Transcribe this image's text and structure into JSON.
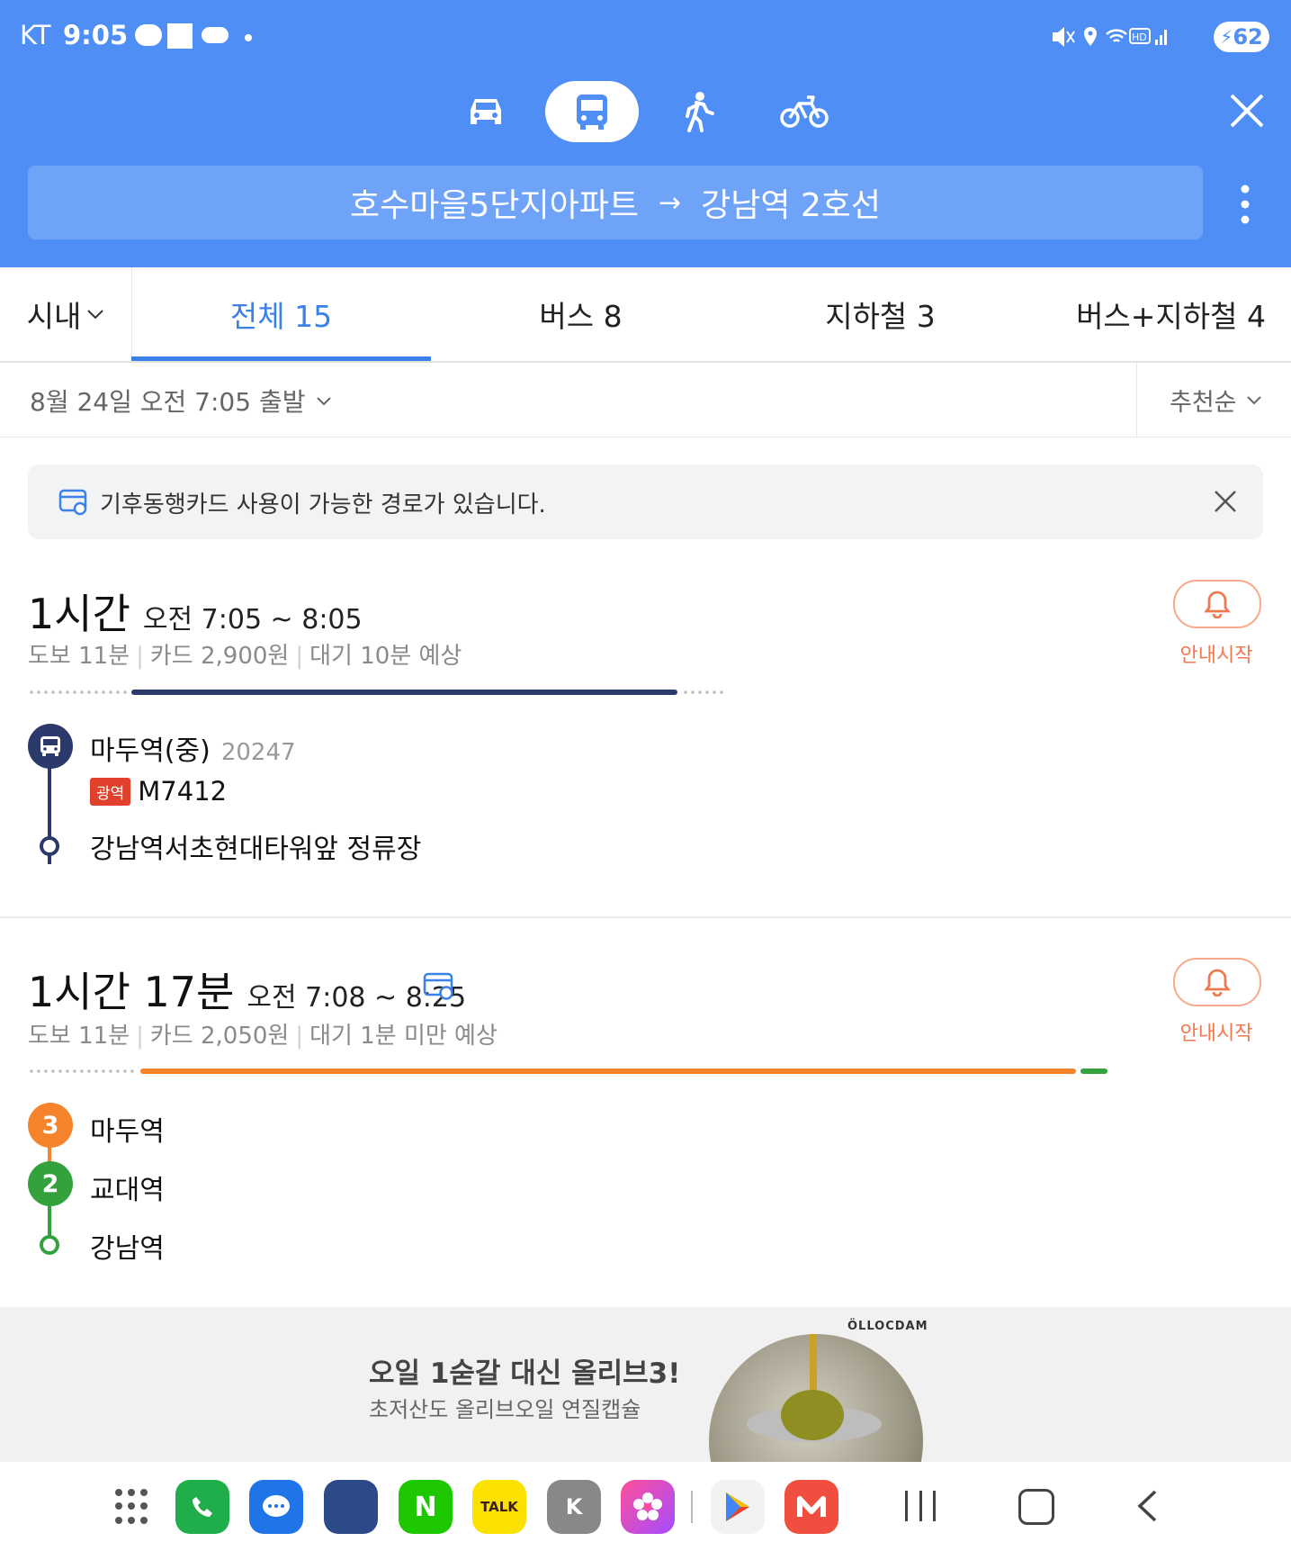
{
  "status_bar": {
    "carrier": "KT",
    "time": "9:05",
    "battery": "62"
  },
  "header": {
    "modes": [
      "car-icon",
      "bus-icon",
      "walk-icon",
      "bike-icon"
    ],
    "active_mode": "bus",
    "origin": "호수마을5단지아파트",
    "arrow": "→",
    "destination": "강남역 2호선"
  },
  "tabs": {
    "region": "시내",
    "items": [
      {
        "label": "전체 15"
      },
      {
        "label": "버스 8"
      },
      {
        "label": "지하철 3"
      },
      {
        "label": "버스+지하철 4"
      }
    ]
  },
  "filter": {
    "departure": "8월 24일 오전 7:05 출발",
    "sort": "추천순"
  },
  "notice": {
    "text": "기후동행카드 사용이 가능한 경로가 있습니다."
  },
  "routes": [
    {
      "duration": "1시간",
      "time_range": "오전 7:05 ~ 8:05",
      "walk": "도보 11분",
      "fare": "카드 2,900원",
      "wait": "대기 10분 예상",
      "guide_label": "안내시작",
      "stops": [
        {
          "name": "마두역(중)",
          "code": "20247",
          "badge": "광역",
          "line": "M7412"
        },
        {
          "name": "강남역서초현대타워앞 정류장"
        }
      ]
    },
    {
      "duration": "1시간 17분",
      "time_range": "오전 7:08 ~ 8:25",
      "walk": "도보 11분",
      "fare": "카드 2,050원",
      "wait": "대기 1분 미만 예상",
      "guide_label": "안내시작",
      "stops": [
        {
          "line_no": "3",
          "name": "마두역"
        },
        {
          "line_no": "2",
          "name": "교대역"
        },
        {
          "name": "강남역"
        }
      ]
    }
  ],
  "ad": {
    "headline": "오일 1숟갈 대신 올리브3!",
    "sub": "초저산도 올리브오일 연질캡슐",
    "brand": "ÖLLOCDAM"
  },
  "dock": {
    "apps": [
      "apps-grid-icon",
      "phone-icon",
      "messages-icon",
      "school-app-icon",
      "naver-icon",
      "kakaotalk-icon",
      "k-app-icon",
      "gallery-icon",
      "play-store-icon",
      "m-app-icon"
    ],
    "talk_label": "TALK",
    "k_label": "K",
    "n_label": "N"
  },
  "colors": {
    "header": "#4f8ef5",
    "accent": "#3b82e8",
    "bus_navy": "#2b3a6b",
    "line3": "#f5832b",
    "line2": "#33a23d",
    "guide": "#f07a50"
  }
}
